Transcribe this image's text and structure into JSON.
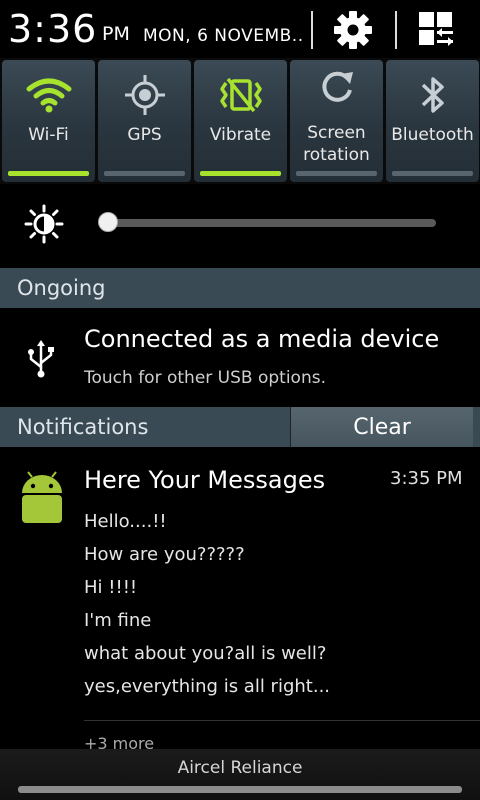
{
  "header": {
    "time": "3:36",
    "ampm": "PM",
    "date": "MON, 6 NOVEMB..",
    "settings_icon": "gear-icon",
    "panel_icon": "grid-toggle-icon"
  },
  "toggles": [
    {
      "label": "Wi-Fi",
      "icon": "wifi-icon",
      "active": true
    },
    {
      "label": "GPS",
      "icon": "gps-icon",
      "active": false
    },
    {
      "label": "Vibrate",
      "icon": "vibrate-icon",
      "active": true
    },
    {
      "label1": "Screen",
      "label2": "rotation",
      "icon": "rotation-icon",
      "active": false
    },
    {
      "label": "Bluetooth",
      "icon": "bluetooth-icon",
      "active": false
    }
  ],
  "brightness": {
    "icon": "brightness-icon",
    "level": 0.0
  },
  "ongoing": {
    "section_title": "Ongoing",
    "title": "Connected as a media device",
    "subtitle": "Touch for other USB options.",
    "icon": "usb-icon"
  },
  "notifications": {
    "section_title": "Notifications",
    "clear_label": "Clear",
    "item": {
      "icon": "android-icon",
      "title": "Here Your Messages",
      "time": "3:35 PM",
      "lines": [
        "Hello....!!",
        "How are you?????",
        "Hi !!!!",
        "I'm fine",
        "what about you?all is well?",
        "yes,everything is all right..."
      ],
      "more": "+3 more"
    }
  },
  "bottom": {
    "carrier": "Aircel Reliance"
  },
  "colors": {
    "accent": "#a6e22e",
    "tile": "#2f3c45",
    "section": "#3a4a55"
  }
}
